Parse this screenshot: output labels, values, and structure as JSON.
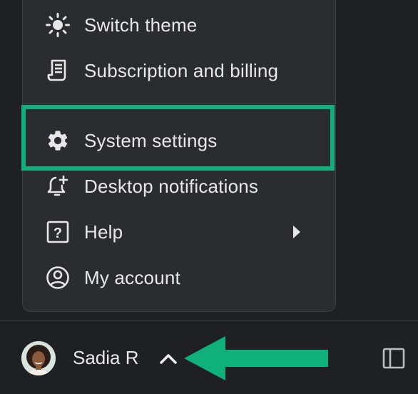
{
  "menu": {
    "items": [
      {
        "label": "Switch theme",
        "icon": "sun-icon"
      },
      {
        "label": "Subscription and billing",
        "icon": "receipt-icon"
      },
      {
        "label": "System settings",
        "icon": "gear-icon"
      },
      {
        "label": "Desktop notifications",
        "icon": "bell-plus-icon"
      },
      {
        "label": "Help",
        "icon": "help-square-icon"
      },
      {
        "label": "My account",
        "icon": "account-circle-icon"
      }
    ]
  },
  "footer": {
    "username": "Sadia R"
  },
  "colors": {
    "highlight": "#10b07a",
    "arrow": "#10b07a",
    "background": "#1f2023",
    "menu": "#2b2c30"
  }
}
